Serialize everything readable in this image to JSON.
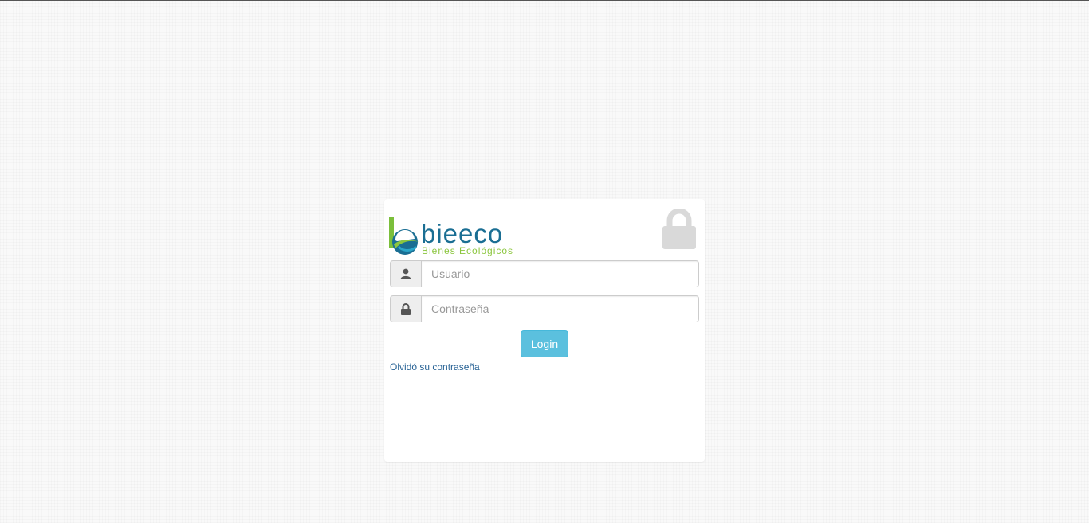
{
  "logo": {
    "name": "bieeco",
    "tagline": "Bienes Ecológicos"
  },
  "form": {
    "username_placeholder": "Usuario",
    "password_placeholder": "Contraseña",
    "login_label": "Login",
    "forgot_label": "Olvidó su contraseña"
  },
  "icons": {
    "header": "lock-icon",
    "username": "user-icon",
    "password": "padlock-icon"
  },
  "colors": {
    "button": "#5bc0de",
    "link": "#2a6496",
    "logo_blue": "#1a6e93",
    "logo_green": "#8cc63f"
  }
}
